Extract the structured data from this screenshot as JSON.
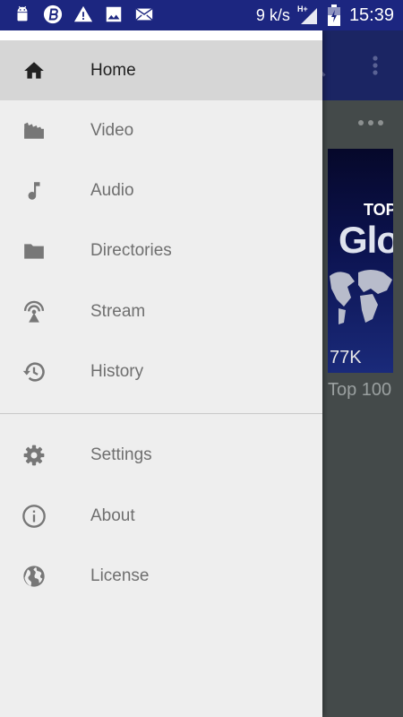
{
  "status_bar": {
    "net_speed": "9 k/s",
    "network_type": "H+",
    "time": "15:39",
    "icons": [
      "android-icon",
      "b-app-icon",
      "warning-icon",
      "image-icon",
      "mail-icon"
    ]
  },
  "drawer": {
    "primary_items": [
      {
        "label": "Home",
        "icon": "home-icon",
        "active": true
      },
      {
        "label": "Video",
        "icon": "video-icon"
      },
      {
        "label": "Audio",
        "icon": "music-note-icon"
      },
      {
        "label": "Directories",
        "icon": "folder-icon"
      },
      {
        "label": "Stream",
        "icon": "stream-icon"
      },
      {
        "label": "History",
        "icon": "history-icon"
      }
    ],
    "secondary_items": [
      {
        "label": "Settings",
        "icon": "gear-icon"
      },
      {
        "label": "About",
        "icon": "info-icon"
      },
      {
        "label": "License",
        "icon": "globe-icon"
      }
    ]
  },
  "background": {
    "card": {
      "thumb_top": "TOP",
      "thumb_big": "Glo",
      "views": "77K",
      "title": "Top 100"
    }
  },
  "colors": {
    "status_bar": "#1c2680",
    "toolbar": "#1b2563",
    "drawer_bg": "#eeeeee",
    "active_item_bg": "#d6d6d6",
    "scrim_bg": "#444a4a"
  }
}
